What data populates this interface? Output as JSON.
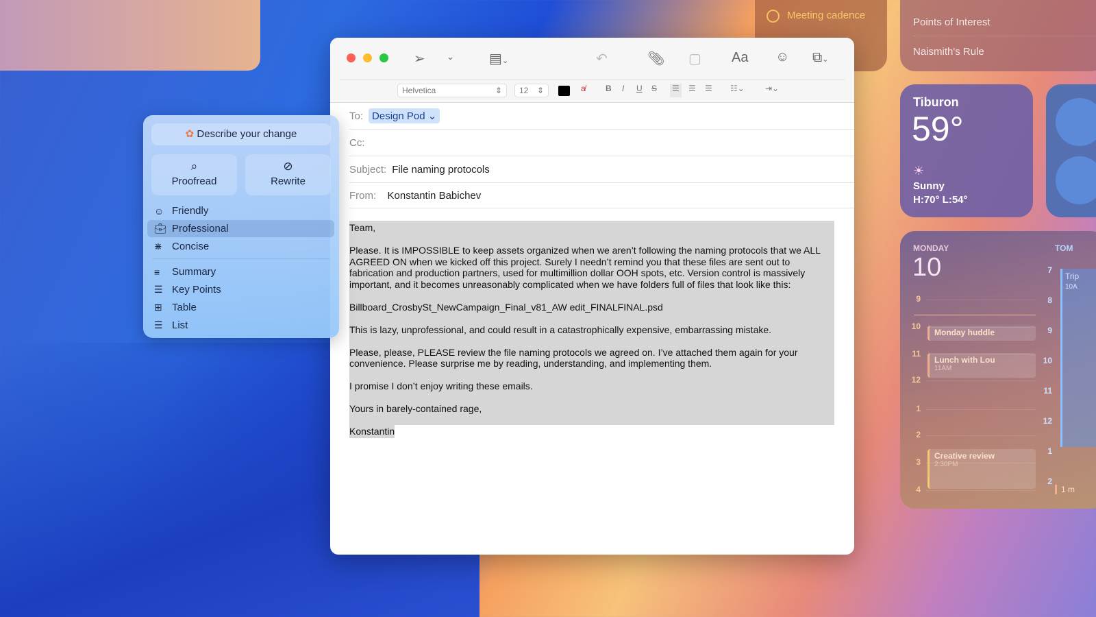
{
  "widgets": {
    "reminder": {
      "title": "Meeting cadence",
      "accent": "#f7c867"
    },
    "notes": {
      "items": [
        "Points of Interest",
        "Naismith's Rule"
      ]
    },
    "weather": {
      "city": "Tiburon",
      "temp": "59°",
      "condition": "Sunny",
      "high_low": "H:70° L:54°",
      "icon": "sun-icon"
    },
    "calendar": {
      "day": "MONDAY",
      "date": "10",
      "tomorrow_label": "TOM",
      "hours": [
        "9",
        "10",
        "11",
        "12",
        "1",
        "2",
        "3",
        "4"
      ],
      "tomorrow_hours": [
        "7",
        "8",
        "9",
        "10",
        "11",
        "12",
        "1",
        "2"
      ],
      "events": [
        {
          "title": "Monday huddle",
          "time": ""
        },
        {
          "title": "Lunch with Lou",
          "time": "11AM"
        },
        {
          "title": "Creative review",
          "time": "2:30PM"
        }
      ],
      "tomorrow_events": [
        {
          "title": "Trip",
          "time": "10A"
        },
        {
          "title": "1 m",
          "time": ""
        }
      ]
    }
  },
  "mail": {
    "toolbar": {
      "font": "Helvetica",
      "size": "12",
      "icons": [
        "send-icon",
        "chevron-down-icon",
        "header-fields-icon",
        "reply-icon",
        "attachment-icon",
        "markup-icon",
        "fonts-icon",
        "emoji-icon",
        "photo-browser-icon"
      ],
      "fonts_label": "Aa"
    },
    "to_label": "To:",
    "to": "Design Pod",
    "cc_label": "Cc:",
    "subject_label": "Subject:",
    "subject": "File naming protocols",
    "from_label": "From:",
    "from": "Konstantin Babichev",
    "body": [
      "Team,",
      "Please. It is IMPOSSIBLE to keep assets organized when we aren’t following the naming protocols that we ALL AGREED ON when we kicked off this project. Surely I needn’t remind you that these files are sent out to fabrication and production partners, used for multimillion dollar OOH spots, etc. Version control is massively important, and it becomes unreasonably complicated when we have folders full of files that look like this:",
      "Billboard_CrosbySt_NewCampaign_Final_v81_AW edit_FINALFINAL.psd",
      "This is lazy, unprofessional, and could result in a catastrophically expensive, embarrassing mistake.",
      "Please, please, PLEASE review the file naming protocols we agreed on. I’ve attached them again for your convenience. Please surprise me by reading, understanding, and implementing them.",
      "I promise I don’t enjoy writing these emails.",
      "Yours in barely-contained rage,",
      "Konstantin"
    ]
  },
  "writing_tools": {
    "describe": "Describe your change",
    "proofread": "Proofread",
    "rewrite": "Rewrite",
    "tones": [
      {
        "label": "Friendly",
        "icon": "smiley-icon"
      },
      {
        "label": "Professional",
        "icon": "briefcase-icon",
        "selected": true
      },
      {
        "label": "Concise",
        "icon": "compress-icon"
      }
    ],
    "formats": [
      {
        "label": "Summary",
        "icon": "summary-icon"
      },
      {
        "label": "Key Points",
        "icon": "list-bullets-icon"
      },
      {
        "label": "Table",
        "icon": "table-icon"
      },
      {
        "label": "List",
        "icon": "list-icon"
      }
    ]
  }
}
